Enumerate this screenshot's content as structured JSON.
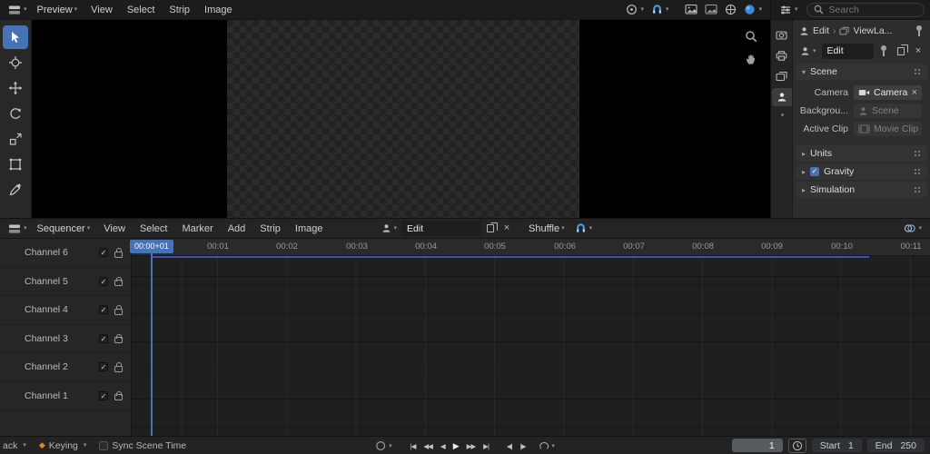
{
  "colors": {
    "accent": "#4772b3",
    "snap_blue": "#47a0e8",
    "keying_orange": "#dd8a1c"
  },
  "preview": {
    "editor_label": "Preview",
    "menus": [
      "View",
      "Select",
      "Strip",
      "Image"
    ]
  },
  "properties": {
    "search_placeholder": "Search",
    "breadcrumb": {
      "item1": "Edit",
      "item2": "ViewLa..."
    },
    "id_name": "Edit",
    "scene_panel": {
      "title": "Scene",
      "rows": [
        {
          "label": "Camera",
          "value": "Camera"
        },
        {
          "label": "Backgrou...",
          "value": "Scene"
        },
        {
          "label": "Active Clip",
          "value": "Movie Clip"
        }
      ]
    },
    "collapsed_panels": [
      {
        "title": "Units"
      },
      {
        "title": "Gravity"
      },
      {
        "title": "Simulation"
      }
    ]
  },
  "sequencer": {
    "editor_label": "Sequencer",
    "menus": [
      "View",
      "Select",
      "Marker",
      "Add",
      "Strip",
      "Image"
    ],
    "id_name": "Edit",
    "channel_dropdown": "Shuffle",
    "channels": [
      "Channel 6",
      "Channel 5",
      "Channel 4",
      "Channel 3",
      "Channel 2",
      "Channel 1"
    ],
    "ruler": [
      "00:01",
      "00:02",
      "00:03",
      "00:04",
      "00:05",
      "00:06",
      "00:07",
      "00:08",
      "00:09",
      "00:10",
      "00:11"
    ],
    "playhead_label": "00:00+01"
  },
  "statusbar": {
    "playback_label": "ack",
    "keying_label": "Keying",
    "sync_label": "Sync Scene Time",
    "transport": {
      "jump_start": "|◀",
      "prev_key": "◀◀",
      "play_back": "◀",
      "play": "▶",
      "next_key": "▶▶",
      "jump_end": "▶|",
      "step_back": "◀|",
      "step_fwd": "|▶"
    },
    "frame_current": "1",
    "range": {
      "start_label": "Start",
      "start_value": "1",
      "end_label": "End",
      "end_value": "250"
    }
  }
}
